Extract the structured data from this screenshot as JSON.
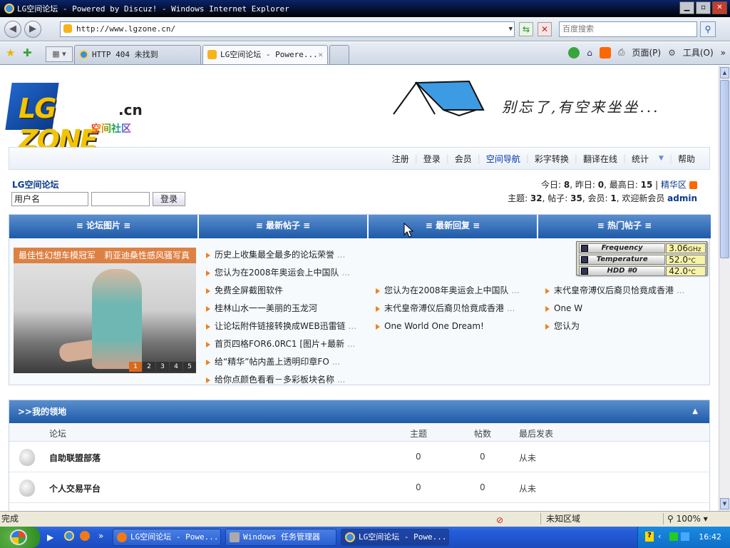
{
  "window": {
    "title": "LG空间论坛 - Powered by Discuz! - Windows Internet Explorer"
  },
  "address": {
    "url": "http://www.lgzone.cn/",
    "search_placeholder": "百度搜索"
  },
  "tabs": [
    {
      "label": "HTTP 404 未找到"
    },
    {
      "label": "LG空间论坛 - Powere..."
    }
  ],
  "commandbar": {
    "page": "页面(P)",
    "tools": "工具(O)"
  },
  "logo": {
    "text": "LG ZONE",
    "cn": ".cn",
    "sub": "空间社区"
  },
  "banner": {
    "slogan": "别忘了,有空来坐坐..."
  },
  "topnav": {
    "items": [
      "注册",
      "登录",
      "会员",
      "空间导航",
      "彩字转换",
      "翻译在线",
      "统计",
      "帮助"
    ]
  },
  "forum": {
    "title": "LG空间论坛",
    "username_placeholder": "用户名",
    "login_label": "登录"
  },
  "stats": {
    "line1_prefix": "今日: ",
    "today": "8",
    "sep1": ", 昨日: ",
    "yesterday": "0",
    "sep2": ", 最高日: ",
    "max": "15",
    "sep3": " | ",
    "best": "精华区",
    "line2_prefix": "主题: ",
    "topics": "32",
    "s4": ", 帖子: ",
    "posts": "35",
    "s5": ", 会员: ",
    "members": "1",
    "s6": ", 欢迎新会员 ",
    "newuser": "admin"
  },
  "panel": {
    "headers": [
      "≡ 论坛图片 ≡",
      "≡ 最新帖子 ≡",
      "≡ 最新回复 ≡",
      "≡ 热门帖子 ≡"
    ],
    "photo_caption": "最佳性幻想车模冠军　莉亚迪桑性感风骚写真",
    "pager": [
      "1",
      "2",
      "3",
      "4",
      "5"
    ],
    "latest_posts": [
      "历史上收集最全最多的论坛荣誉",
      "您认为在2008年奥运会上中国队",
      "免费全屏截图软件",
      "桂林山水一一美丽的玉龙河",
      "让论坛附件链接转换成WEB迅雷链",
      "首页四格FOR6.0RC1 [图片+最新",
      "给“精华”帖内盖上透明印章FO",
      "给你点颜色看看－多彩板块名称"
    ],
    "latest_posts_ellipsis": [
      "...",
      "...",
      "",
      "",
      "...",
      "...",
      "...",
      "..."
    ],
    "latest_replies": [
      "您认为在2008年奥运会上中国队",
      "末代皇帝溥仪后裔贝恰竟成香港",
      "One World One Dream!"
    ],
    "latest_replies_ellipsis": [
      "...",
      "...",
      ""
    ],
    "hot_posts": [
      "末代皇帝溥仪后裔贝恰竟成香港",
      "One W",
      "您认为"
    ],
    "hot_posts_ellipsis": [
      "...",
      "",
      ""
    ]
  },
  "gadget": {
    "rows": [
      {
        "label": "Frequency",
        "value": "3.06",
        "unit": "GHz"
      },
      {
        "label": "Temperature",
        "value": "52.0",
        "unit": "°C"
      },
      {
        "label": "HDD #0",
        "value": "42.0",
        "unit": "°C"
      }
    ]
  },
  "myarea": {
    "title": ">>我的领地",
    "columns": [
      "论坛",
      "主题",
      "帖数",
      "最后发表"
    ],
    "rows": [
      {
        "name": "自助联盟部落",
        "topics": "0",
        "posts": "0",
        "last": "从未"
      },
      {
        "name": "个人交易平台",
        "topics": "0",
        "posts": "0",
        "last": "从未"
      }
    ]
  },
  "statusbar": {
    "text": "完成",
    "zone": "未知区域",
    "zoom": "100%"
  },
  "taskbar": {
    "buttons": [
      "LG空间论坛 - Powe...",
      "Windows 任务管理器",
      "LG空间论坛 - Powe..."
    ],
    "clock": "16:42"
  }
}
